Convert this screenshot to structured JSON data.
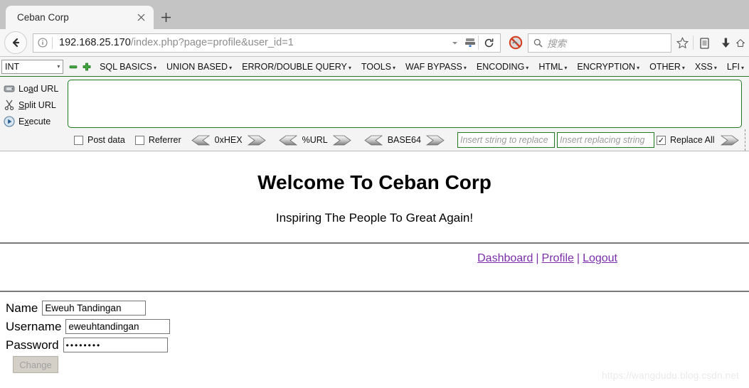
{
  "browser": {
    "tab": {
      "title": "Ceban Corp",
      "close_icon": "close-icon",
      "new_tab_icon": "plus-icon"
    },
    "back_icon": "back-arrow-icon",
    "info_icon": "info-icon",
    "url_prefix": "192.168.25.170",
    "url_suffix": "/index.php?page=profile&user_id=1",
    "url_full": "192.168.25.170/index.php?page=profile&user_id=1",
    "dropdown_icon": "chevron-down-icon",
    "server_icon": "server-icon",
    "reload_icon": "reload-icon",
    "block_icon": "no-script-blocked-icon",
    "search_placeholder": "搜索",
    "search_icon": "search-icon",
    "bookmark_icon": "star-icon",
    "reading_list_icon": "clipboard-icon",
    "download_icon": "download-arrow-icon",
    "home_icon": "home-icon"
  },
  "hackbar": {
    "type_select": {
      "value": "INT",
      "chevron": "chevron-down-icon"
    },
    "minus_label": "−",
    "plus_label": "+",
    "menu": [
      {
        "label": "SQL BASICS",
        "caret": "▾"
      },
      {
        "label": "UNION BASED",
        "caret": "▾"
      },
      {
        "label": "ERROR/DOUBLE QUERY",
        "caret": "▾"
      },
      {
        "label": "TOOLS",
        "caret": "▾"
      },
      {
        "label": "WAF BYPASS",
        "caret": "▾"
      },
      {
        "label": "ENCODING",
        "caret": "▾"
      },
      {
        "label": "HTML",
        "caret": "▾"
      },
      {
        "label": "ENCRYPTION",
        "caret": "▾"
      },
      {
        "label": "OTHER",
        "caret": "▾"
      },
      {
        "label": "XSS",
        "caret": "▾"
      },
      {
        "label": "LFI",
        "caret": "▾"
      }
    ],
    "side_buttons": [
      {
        "label_pre": "Lo",
        "label_accel": "a",
        "label_post": "d URL",
        "icon": "load-url-icon"
      },
      {
        "label_pre": "",
        "label_accel": "S",
        "label_post": "plit URL",
        "icon": "scissors-icon"
      },
      {
        "label_pre": "E",
        "label_accel": "x",
        "label_post": "ecute",
        "icon": "play-icon"
      }
    ],
    "textarea_value": "",
    "options": {
      "post_data": {
        "label": "Post data",
        "checked": false
      },
      "referrer": {
        "label": "Referrer",
        "checked": false
      },
      "encoders": [
        "0xHEX",
        "%URL",
        "BASE64"
      ],
      "replace_search_placeholder": "Insert string to replace",
      "replace_with_placeholder": "Insert replacing string",
      "replace_all": {
        "label": "Replace All",
        "checked": true,
        "mark": "✓"
      }
    },
    "accent_green": "#1f7a1f"
  },
  "page": {
    "heading": "Welcome To Ceban Corp",
    "subheading": "Inspiring The People To Great Again!",
    "nav": [
      {
        "label": "Dashboard"
      },
      {
        "label": "Profile"
      },
      {
        "label": "Logout"
      }
    ],
    "nav_separator": "|",
    "link_color": "#7a2ea8",
    "form": {
      "fields": [
        {
          "label": "Name",
          "value": "Eweuh Tandingan",
          "type": "text"
        },
        {
          "label": "Username",
          "value": "eweuhtandingan",
          "type": "text"
        },
        {
          "label": "Password",
          "value": "••••••••",
          "type": "password"
        }
      ],
      "submit": {
        "label": "Change",
        "disabled": true
      }
    }
  },
  "watermark": "https://wangdudu.blog.csdn.net"
}
